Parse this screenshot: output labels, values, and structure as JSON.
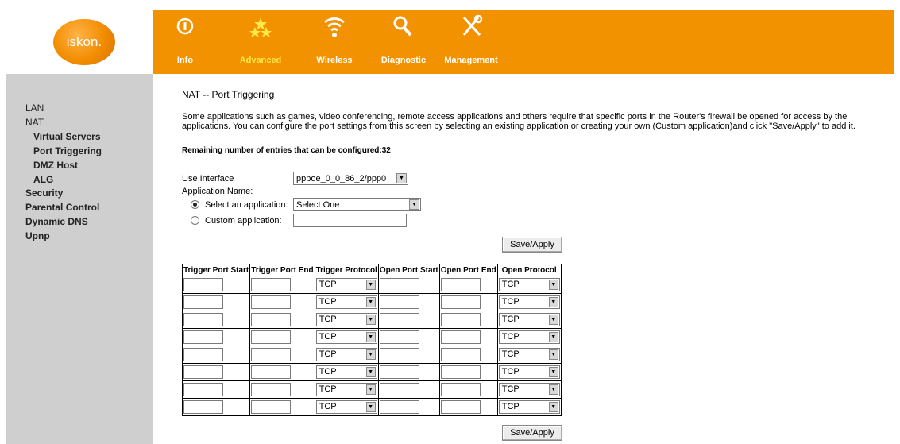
{
  "logo": {
    "text": "iskon."
  },
  "nav": [
    {
      "label": "Info",
      "icon": "info-icon",
      "active": false
    },
    {
      "label": "Advanced",
      "icon": "stars-icon",
      "active": true
    },
    {
      "label": "Wireless",
      "icon": "wifi-icon",
      "active": false
    },
    {
      "label": "Diagnostic",
      "icon": "magnifier-icon",
      "active": false
    },
    {
      "label": "Management",
      "icon": "tools-icon",
      "active": false
    }
  ],
  "sidebar": {
    "items": [
      {
        "label": "LAN"
      },
      {
        "label": "NAT"
      },
      {
        "label": "Virtual Servers"
      },
      {
        "label": "Port Triggering"
      },
      {
        "label": "DMZ Host"
      },
      {
        "label": "ALG"
      },
      {
        "label": "Security"
      },
      {
        "label": "Parental Control"
      },
      {
        "label": "Dynamic DNS"
      },
      {
        "label": "Upnp"
      }
    ]
  },
  "main": {
    "title": "NAT -- Port Triggering",
    "description": "Some applications such as games, video conferencing, remote access applications and others require that specific ports in the Router's firewall be opened for access by the applications. You can configure the port settings from this screen by selecting an existing application or creating your own (Custom application)and click \"Save/Apply\" to add it.",
    "remaining": "Remaining number of entries that can be configured:32",
    "use_interface_label": "Use Interface",
    "use_interface_value": "pppoe_0_0_86_2/ppp0",
    "app_name_label": "Application Name:",
    "select_app_label": "Select an application:",
    "select_app_value": "Select One",
    "custom_app_label": "Custom application:",
    "save_label": "Save/Apply"
  },
  "table": {
    "headers": [
      "Trigger Port Start",
      "Trigger Port End",
      "Trigger Protocol",
      "Open Port Start",
      "Open Port End",
      "Open Protocol"
    ],
    "rows": [
      {
        "trigger_protocol": "TCP",
        "open_protocol": "TCP"
      },
      {
        "trigger_protocol": "TCP",
        "open_protocol": "TCP"
      },
      {
        "trigger_protocol": "TCP",
        "open_protocol": "TCP"
      },
      {
        "trigger_protocol": "TCP",
        "open_protocol": "TCP"
      },
      {
        "trigger_protocol": "TCP",
        "open_protocol": "TCP"
      },
      {
        "trigger_protocol": "TCP",
        "open_protocol": "TCP"
      },
      {
        "trigger_protocol": "TCP",
        "open_protocol": "TCP"
      },
      {
        "trigger_protocol": "TCP",
        "open_protocol": "TCP"
      }
    ]
  },
  "colors": {
    "header_orange": "#f39200",
    "sidebar_gray": "#cfcfcf",
    "active_nav": "#ffe94a"
  }
}
